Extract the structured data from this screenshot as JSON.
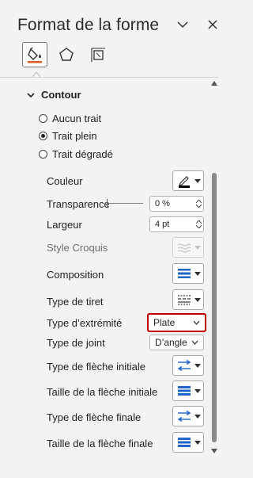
{
  "pane": {
    "title": "Format de la forme",
    "dropdown_icon": "chevron-down-icon",
    "close_icon": "close-icon"
  },
  "tabs": [
    {
      "icon": "fill-line-icon",
      "selected": true
    },
    {
      "icon": "effects-pentagon-icon",
      "selected": false
    },
    {
      "icon": "size-properties-icon",
      "selected": false
    }
  ],
  "section": {
    "title": "Contour",
    "expanded": true
  },
  "line_options": [
    {
      "label": "Aucun trait",
      "checked": false
    },
    {
      "label": "Trait plein",
      "checked": true
    },
    {
      "label": "Trait dégradé",
      "checked": false
    }
  ],
  "props": {
    "couleur": {
      "label": "Couleur",
      "swatch_color": "#000000"
    },
    "transparence": {
      "label": "Transparence",
      "value": "0 %",
      "slider_fraction": 0.0
    },
    "largeur": {
      "label": "Largeur",
      "value": "4 pt"
    },
    "style_croquis": {
      "label": "Style Croquis"
    },
    "composition": {
      "label": "Composition"
    },
    "type_tiret": {
      "label": "Type de tiret"
    },
    "type_extremite": {
      "label": "Type d’extrémité",
      "value": "Plate"
    },
    "type_joint": {
      "label": "Type de joint",
      "value": "D’angle"
    },
    "type_fleche_initiale": {
      "label": "Type de flèche initiale"
    },
    "taille_fleche_initiale": {
      "label": "Taille de la flèche initiale"
    },
    "type_fleche_finale": {
      "label": "Type de flèche finale"
    },
    "taille_fleche_finale": {
      "label": "Taille de la flèche finale"
    }
  },
  "colors": {
    "accent_blue": "#1e66c9",
    "focus_red": "#c00000",
    "tab_icon_orange": "#e35d20"
  }
}
